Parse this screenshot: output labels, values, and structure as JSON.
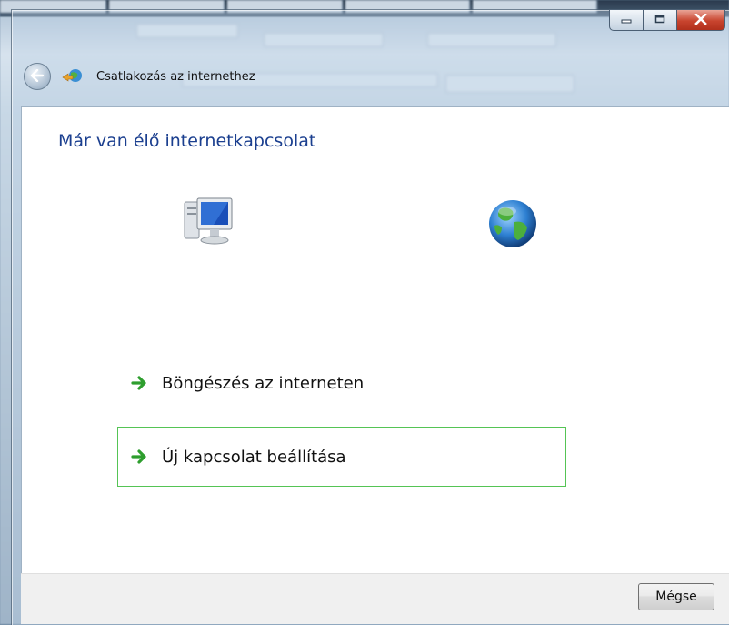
{
  "window": {
    "title": "Csatlakozás az internethez",
    "controls": {
      "minimize_icon": "minimize-icon",
      "maximize_icon": "maximize-icon",
      "close_icon": "close-icon"
    }
  },
  "content": {
    "heading": "Már van élő internetkapcsolat",
    "diagram": {
      "left_icon": "computer-icon",
      "right_icon": "globe-icon"
    },
    "options": [
      {
        "label": "Böngészés az interneten",
        "icon": "green-arrow-icon"
      },
      {
        "label": "Új kapcsolat beállítása",
        "icon": "green-arrow-icon",
        "highlighted": true
      }
    ]
  },
  "footer": {
    "cancel_label": "Mégse"
  },
  "colors": {
    "heading": "#1b3f8f",
    "highlight_border": "#55c455",
    "arrow": "#2e9e2e",
    "close_button": "#c8442e"
  }
}
